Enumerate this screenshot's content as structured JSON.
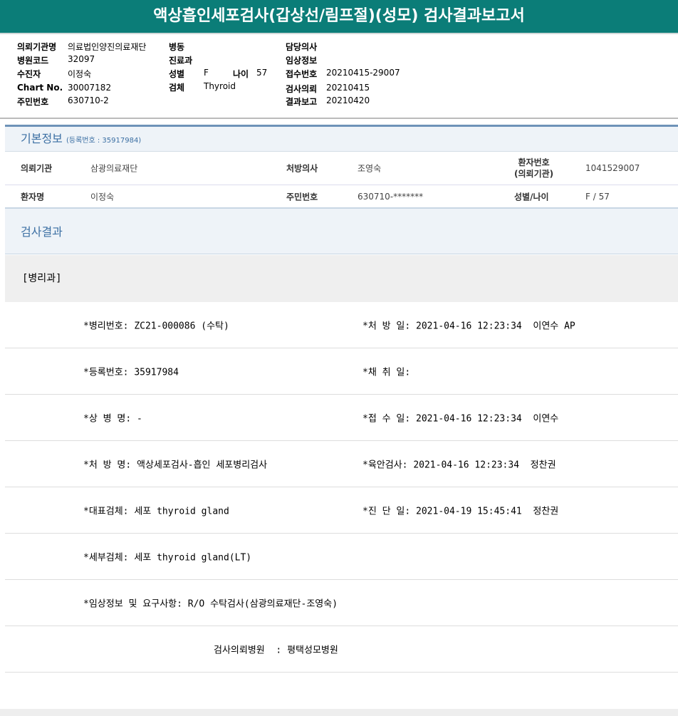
{
  "title": "액상흡인세포검사(갑상선/림프절)(성모) 검사결과보고서",
  "header": [
    {
      "label": "의뢰기관명",
      "value": "의료법인양진의료재단"
    },
    {
      "label": "병원코드",
      "value": "32097"
    },
    {
      "label": "수진자",
      "value": "이정숙"
    },
    {
      "label": "Chart No.",
      "value": "30007182"
    },
    {
      "label": "주민번호",
      "value": "630710-2"
    },
    {
      "label": "병동",
      "value": ""
    },
    {
      "label": "진료과",
      "value": ""
    },
    {
      "label": "성별",
      "value": "F"
    },
    {
      "label": "검체",
      "value": "Thyroid"
    },
    {
      "label": "나이",
      "value": "57"
    },
    {
      "label": "담당의사",
      "value": ""
    },
    {
      "label": "임상정보",
      "value": ""
    },
    {
      "label": "접수번호",
      "value": "20210415-29007"
    },
    {
      "label": "검사의뢰",
      "value": "20210415"
    },
    {
      "label": "결과보고",
      "value": "20210420"
    }
  ],
  "basic": {
    "title": "기본정보",
    "reg": "(등록번호 : 35917984)",
    "fields": [
      {
        "label": "의뢰기관",
        "value": "삼광의료재단"
      },
      {
        "label": "처방의사",
        "value": "조영숙"
      },
      {
        "label": "환자번호",
        "label2": "(의뢰기관)",
        "value": "1041529007"
      },
      {
        "label": "환자명",
        "value": "이정숙"
      },
      {
        "label": "주민번호",
        "value": "630710-*******"
      },
      {
        "label": "성별/나이",
        "value": "F / 57"
      }
    ]
  },
  "results": {
    "title": "검사결과",
    "dept": "[병리과]",
    "rows": [
      {
        "left": "*병리번호: ZC21-000086 (수탁)",
        "right": "*처 방 일: 2021-04-16 12:23:34  이연수 AP"
      },
      {
        "left": "*등록번호: 35917984",
        "right": "*채 취 일:"
      },
      {
        "left": "*상 병 명: -",
        "right": "*접 수 일: 2021-04-16 12:23:34  이연수"
      },
      {
        "left": "*처 방 명: 액상세포검사-흡인 세포병리검사",
        "right": "*육안검사: 2021-04-16 12:23:34  정찬권"
      },
      {
        "left": "*대표검체: 세포 thyroid gland",
        "right": "*진 단 일: 2021-04-19 15:45:41  정찬권"
      },
      {
        "left": "*세부검체: 세포 thyroid gland(LT)",
        "right": ""
      },
      {
        "left": "*임상정보 및 요구사항: R/O 수탁검사(삼광의료재단-조영숙)",
        "right": ""
      }
    ],
    "hospital": "검사의뢰병원  : 평택성모병원"
  }
}
